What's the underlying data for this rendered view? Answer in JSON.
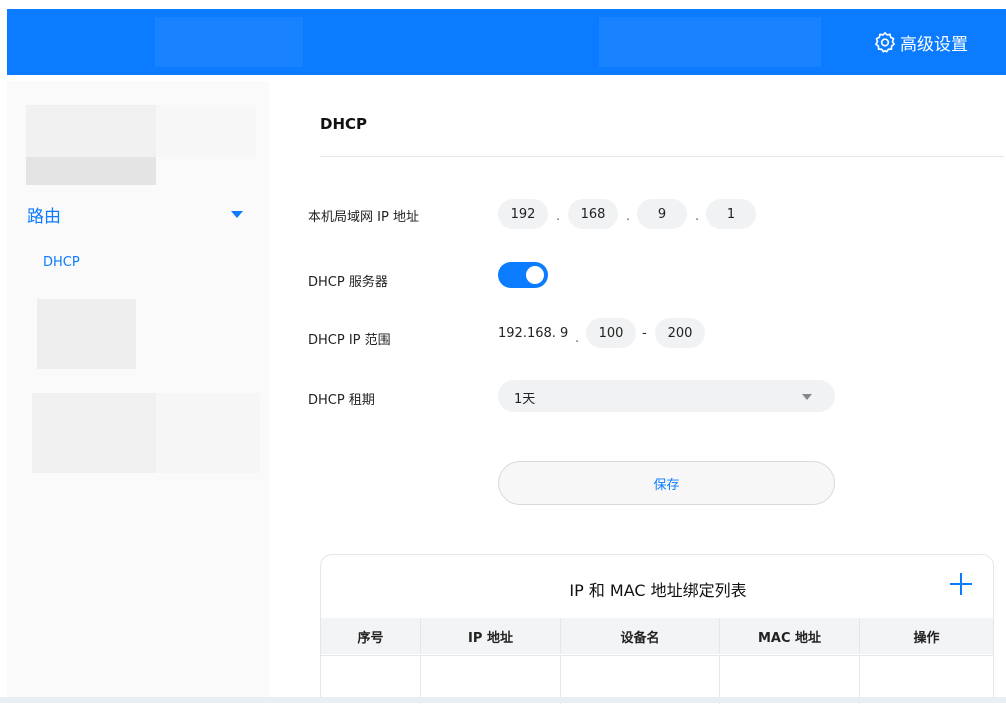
{
  "header": {
    "advanced_settings_label": "高级设置",
    "accent_color": "#0b7bff"
  },
  "sidebar": {
    "section_label": "路由",
    "items": [
      {
        "label": "DHCP",
        "active": true
      }
    ]
  },
  "main": {
    "title": "DHCP",
    "lan_ip": {
      "label": "本机局域网 IP 地址",
      "octets": [
        "192",
        "168",
        "9",
        "1"
      ]
    },
    "dhcp_server": {
      "label": "DHCP 服务器",
      "enabled": true
    },
    "dhcp_range": {
      "label": "DHCP IP 范围",
      "prefix": "192.168. 9",
      "start": "100",
      "end": "200",
      "separator": "-"
    },
    "lease": {
      "label": "DHCP 租期",
      "value": "1天"
    },
    "save_label": "保存"
  },
  "binding_table": {
    "title": "IP 和 MAC 地址绑定列表",
    "columns": [
      "序号",
      "IP 地址",
      "设备名",
      "MAC 地址",
      "操作"
    ]
  }
}
